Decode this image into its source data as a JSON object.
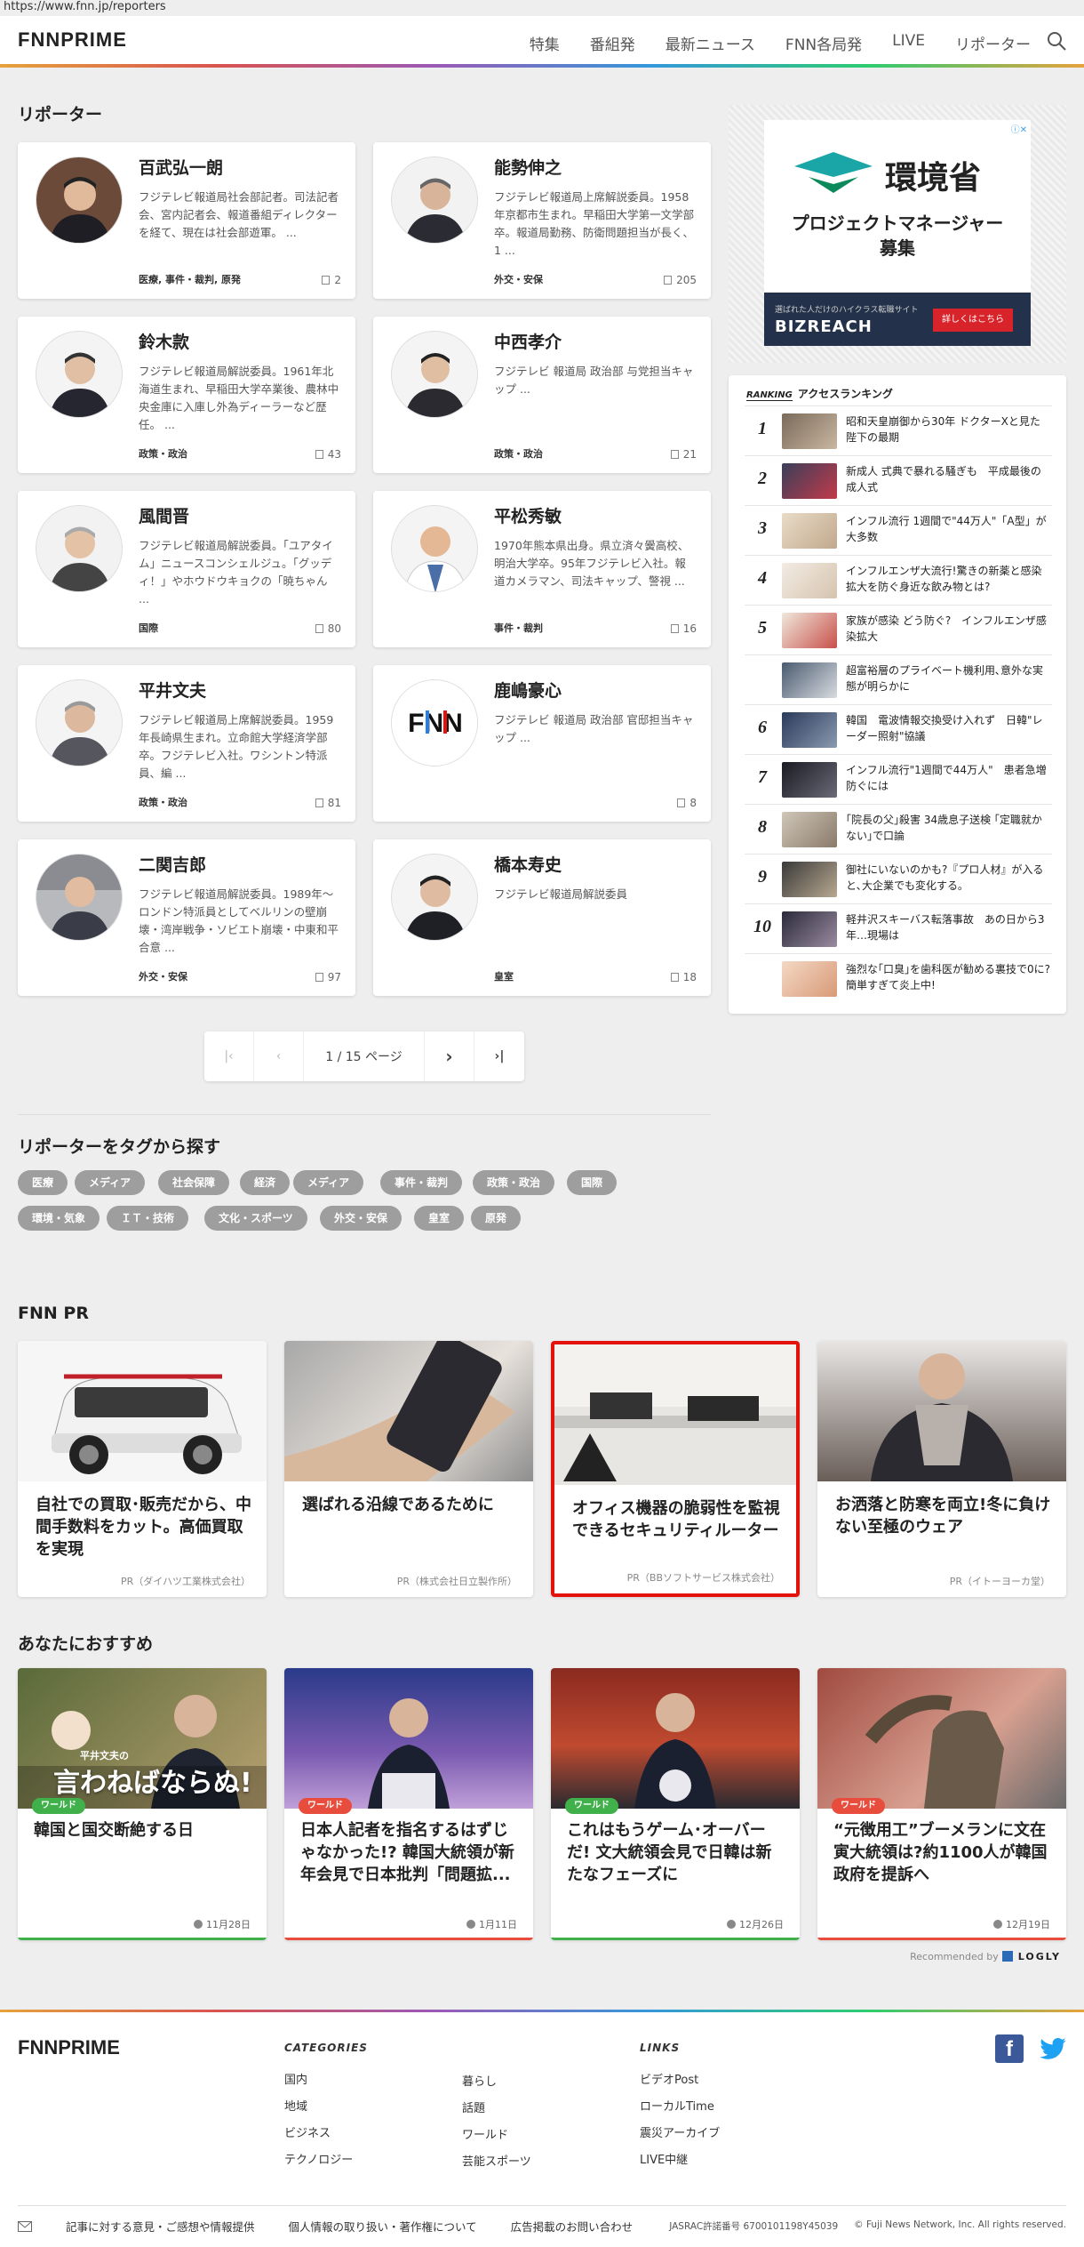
{
  "url": "https://www.fnn.jp/reporters",
  "header": {
    "logo": "FNNPRIME",
    "nav": [
      "特集",
      "番組発",
      "最新ニュース",
      "FNN各局発",
      "LIVE",
      "リポーター"
    ]
  },
  "reporters": {
    "title": "リポーター",
    "items": [
      {
        "name": "百武弘一朗",
        "desc": "フジテレビ報道局社会部記者。司法記者会、宮内記者会、報道番組ディレクターを経て、現在は社会部遊軍。 ...",
        "tags": "医療, 事件・裁判, 原発",
        "count": "2"
      },
      {
        "name": "能勢伸之",
        "desc": "フジテレビ報道局上席解説委員。1958年京都市生まれ。早稲田大学第一文学部卒。報道局勤務、防衛問題担当が長く、1 ...",
        "tags": "外交・安保",
        "count": "205"
      },
      {
        "name": "鈴木款",
        "desc": "フジテレビ報道局解説委員。1961年北海道生まれ、早稲田大学卒業後、農林中央金庫に入庫し外為ディーラーなど歴任。 ...",
        "tags": "政策・政治",
        "count": "43"
      },
      {
        "name": "中西孝介",
        "desc": "フジテレビ 報道局 政治部 与党担当キャップ ...",
        "tags": "政策・政治",
        "count": "21"
      },
      {
        "name": "風間晋",
        "desc": "フジテレビ報道局解説委員。「ユアタイム」ニュースコンシェルジュ。「グッディ！」やホウドウキョクの「暁ちゃん ...",
        "tags": "国際",
        "count": "80"
      },
      {
        "name": "平松秀敏",
        "desc": "1970年熊本県出身。県立済々黌高校、明治大学卒。95年フジテレビ入社。報道カメラマン、司法キャップ、警視 ...",
        "tags": "事件・裁判",
        "count": "16"
      },
      {
        "name": "平井文夫",
        "desc": "フジテレビ報道局上席解説委員。1959年長崎県生まれ。立命館大学経済学部卒。フジテレビ入社。ワシントン特派員、編 ...",
        "tags": "政策・政治",
        "count": "81"
      },
      {
        "name": "鹿嶋豪心",
        "desc": "フジテレビ 報道局 政治部 官邸担当キャップ ...",
        "tags": "",
        "count": "8"
      },
      {
        "name": "二関吉郎",
        "desc": "フジテレビ報道局解説委員。1989年〜ロンドン特派員としてベルリンの壁崩壊・湾岸戦争・ソビエト崩壊・中東和平合意 ...",
        "tags": "外交・安保",
        "count": "97"
      },
      {
        "name": "橋本寿史",
        "desc": "フジテレビ報道局解説委員",
        "tags": "皇室",
        "count": "18"
      }
    ]
  },
  "pager": {
    "page": "1 / 15 ページ"
  },
  "tags_section": {
    "title": "リポーターをタグから探す",
    "tags": [
      "医療",
      "メディア",
      "社会保障",
      "経済",
      "メディア",
      "事件・裁判",
      "政策・政治",
      "国際",
      "環境・気象",
      "ＩＴ・技術",
      "文化・スポーツ",
      "外交・安保",
      "皇室",
      "原発"
    ]
  },
  "ad": {
    "org": "環境省",
    "line1": "プロジェクトマネージャー",
    "line2": "募集",
    "small": "選ばれた人だけのハイクラス転職サイト",
    "brand": "BIZREACH",
    "cta": "詳しくはこちら"
  },
  "ranking": {
    "label": "RANKING",
    "title": "アクセスランキング",
    "items": [
      {
        "no": "1",
        "text": "昭和天皇崩御から30年 ドクターXと見た陛下の最期"
      },
      {
        "no": "2",
        "text": "新成人 式典で暴れる騒ぎも　平成最後の成人式"
      },
      {
        "no": "3",
        "text": "インフル流行 1週間で\"44万人\"「A型」が大多数"
      },
      {
        "no": "4",
        "text": "インフルエンザ大流行!驚きの新薬と感染拡大を防ぐ身近な飲み物とは?"
      },
      {
        "no": "5",
        "text": "家族が感染 どう防ぐ?　インフルエンザ感染拡大"
      },
      {
        "no": "",
        "text": "超富裕層のプライベート機利用､意外な実態が明らかに"
      },
      {
        "no": "6",
        "text": "韓国　電波情報交換受け入れず　日韓\"レーダー照射\"協議"
      },
      {
        "no": "7",
        "text": "インフル流行\"1週間で44万人\"　患者急増　防ぐには"
      },
      {
        "no": "8",
        "text": "｢院長の父｣殺害 34歳息子送検 ｢定職就かない｣で口論"
      },
      {
        "no": "9",
        "text": "御社にいないのかも?『プロ人材』が入ると､大企業でも変化する｡"
      },
      {
        "no": "10",
        "text": "軽井沢スキーバス転落事故　あの日から3年…現場は"
      },
      {
        "no": "",
        "text": "強烈な｢口臭｣を歯科医が勧める裏技で0に?簡単すぎて炎上中!"
      }
    ]
  },
  "pr": {
    "title": "FNN PR",
    "items": [
      {
        "title": "自社での買取･販売だから、中間手数料をカット。高価買取を実現",
        "sponsor": "PR（ダイハツ工業株式会社）"
      },
      {
        "title": "選ばれる沿線であるために",
        "sponsor": "PR（株式会社日立製作所）"
      },
      {
        "title": "オフィス機器の脆弱性を監視できるセキュリティルーター",
        "sponsor": "PR（BBソフトサービス株式会社）"
      },
      {
        "title": "お洒落と防寒を両立!冬に負けない至極のウェア",
        "sponsor": "PR（イトーヨーカ堂）"
      }
    ]
  },
  "recommend": {
    "title": "あなたにおすすめ",
    "items": [
      {
        "badge": "ワールド",
        "title": "韓国と国交断絶する日",
        "date": "11月28日",
        "overlay_small": "平井文夫の",
        "overlay_big": "言わねばならぬ!"
      },
      {
        "badge": "ワールド",
        "title": "日本人記者を指名するはずじゃなかった!? 韓国大統領が新年会見で日本批判「問題拡...",
        "date": "1月11日"
      },
      {
        "badge": "ワールド",
        "title": "これはもうゲーム･オーバーだ! 文大統領会見で日韓は新たなフェーズに",
        "date": "12月26日"
      },
      {
        "badge": "ワールド",
        "title": "“元徴用工”ブーメランに文在寅大統領は?約1100人が韓国政府を提訴へ",
        "date": "12月19日"
      }
    ],
    "recommended_by": "Recommended by",
    "provider": "LOGLY"
  },
  "footer": {
    "logo": "FNNPRIME",
    "categories_title": "CATEGORIES",
    "categories_col1": [
      "国内",
      "地域",
      "ビジネス",
      "テクノロジー"
    ],
    "categories_col2": [
      "暮らし",
      "話題",
      "ワールド",
      "芸能スポーツ"
    ],
    "links_title": "LINKS",
    "links": [
      "ビデオPost",
      "ローカルTime",
      "震災アーカイブ",
      "LIVE中継"
    ],
    "bottom_links": [
      "記事に対する意見・ご感想や情報提供",
      "個人情報の取り扱い・著作権について",
      "広告掲載のお問い合わせ"
    ],
    "jasrac": "JASRAC許諾番号 6700101198Y45039",
    "copyright": "© Fuji News Network, Inc. All rights reserved."
  },
  "colors": {
    "badge": "#3fb04a",
    "badge_red": "#e74c3c",
    "highlight": "#e3120b",
    "tag": "#9e9e9e"
  }
}
